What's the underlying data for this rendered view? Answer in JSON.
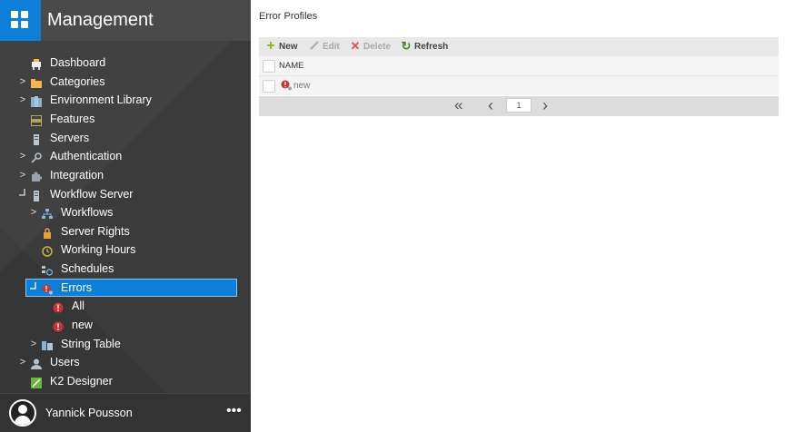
{
  "app": {
    "title": "Management",
    "logo_icon": "grid-logo-icon",
    "accent": "#0e7fd8"
  },
  "nav": [
    {
      "label": "Dashboard",
      "icon": "dashboard-icon",
      "expander": ""
    },
    {
      "label": "Categories",
      "icon": "folder-icon",
      "expander": ">"
    },
    {
      "label": "Environment Library",
      "icon": "building-icon",
      "expander": ">"
    },
    {
      "label": "Features",
      "icon": "features-icon",
      "expander": ""
    },
    {
      "label": "Servers",
      "icon": "server-icon",
      "expander": ""
    },
    {
      "label": "Authentication",
      "icon": "key-icon",
      "expander": ">"
    },
    {
      "label": "Integration",
      "icon": "puzzle-icon",
      "expander": ">"
    },
    {
      "label": "Workflow Server",
      "icon": "server-icon",
      "expander": "collapse"
    },
    {
      "label": "Workflows",
      "icon": "workflow-icon",
      "expander": ">"
    },
    {
      "label": "Server Rights",
      "icon": "lock-icon",
      "expander": ""
    },
    {
      "label": "Working Hours",
      "icon": "clock-icon",
      "expander": ""
    },
    {
      "label": "Schedules",
      "icon": "schedule-icon",
      "expander": ""
    },
    {
      "label": "Errors",
      "icon": "error-icon",
      "expander": "collapse"
    },
    {
      "label": "All",
      "icon": "error-icon",
      "expander": ""
    },
    {
      "label": "new",
      "icon": "error-icon",
      "expander": ""
    },
    {
      "label": "String Table",
      "icon": "string-table-icon",
      "expander": ">"
    },
    {
      "label": "Users",
      "icon": "user-icon",
      "expander": ">"
    },
    {
      "label": "K2 Designer",
      "icon": "designer-icon",
      "expander": ""
    }
  ],
  "user": {
    "name": "Yannick Pousson",
    "more": "•••"
  },
  "main": {
    "title": "Error Profiles",
    "toolbar": {
      "new": "New",
      "edit": "Edit",
      "delete": "Delete",
      "refresh": "Refresh"
    },
    "grid": {
      "column": "NAME",
      "rows": [
        {
          "name": "new"
        }
      ]
    },
    "pager": {
      "first": "«",
      "prev": "‹",
      "page": "1",
      "next": "›"
    }
  }
}
